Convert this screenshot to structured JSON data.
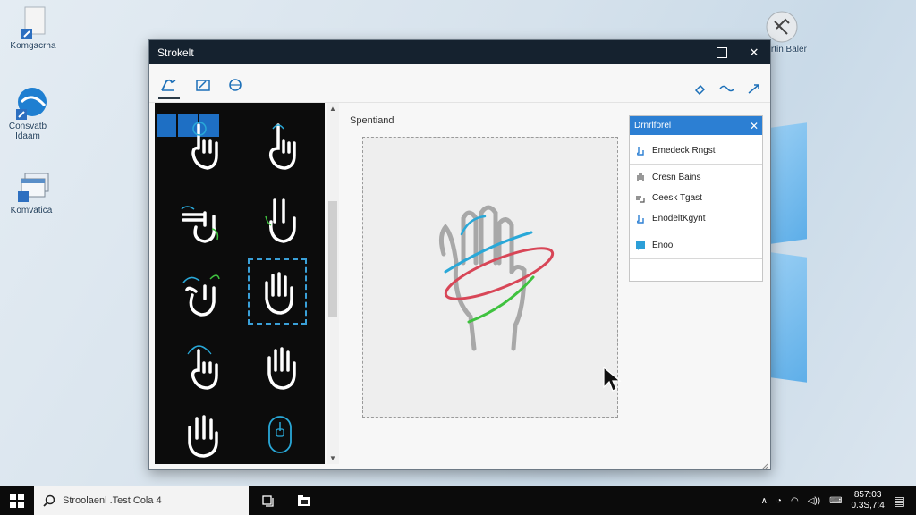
{
  "desktop": {
    "icons": [
      {
        "label": "Komgacrha"
      },
      {
        "label": "Consvatb Idaam"
      },
      {
        "label": "Komvatica"
      },
      {
        "label": "Sanrtin Baler"
      }
    ]
  },
  "window": {
    "title": "Strokelt",
    "controls": {
      "minimize": "minimize",
      "maximize": "maximize",
      "close": "✕"
    }
  },
  "toolbar": {
    "tools": [
      "hand-gesture-tool",
      "gesture-edit-tool",
      "shape-tool"
    ],
    "right_tools": [
      "eraser-tool",
      "wave-tool",
      "arrow-tool"
    ]
  },
  "canvas": {
    "label": "Spentiand"
  },
  "dialog": {
    "title": "Drnrlforel",
    "close": "✕",
    "items": [
      {
        "label": "Emedeck Rngst"
      },
      {
        "label": "Cresn Bains"
      },
      {
        "label": "Ceesk Tgast"
      },
      {
        "label": "EnodeltKgynt"
      },
      {
        "label": "Enool"
      }
    ]
  },
  "taskbar": {
    "search_text": "Stroolaenl .Test Cola 4",
    "time": "857:03",
    "date": "0.3S,7:4"
  },
  "colors": {
    "accent": "#2c7fd3",
    "stroke_blue": "#29a8d8",
    "stroke_red": "#d84657",
    "stroke_green": "#3fc23f",
    "titlebar": "#15222f"
  }
}
